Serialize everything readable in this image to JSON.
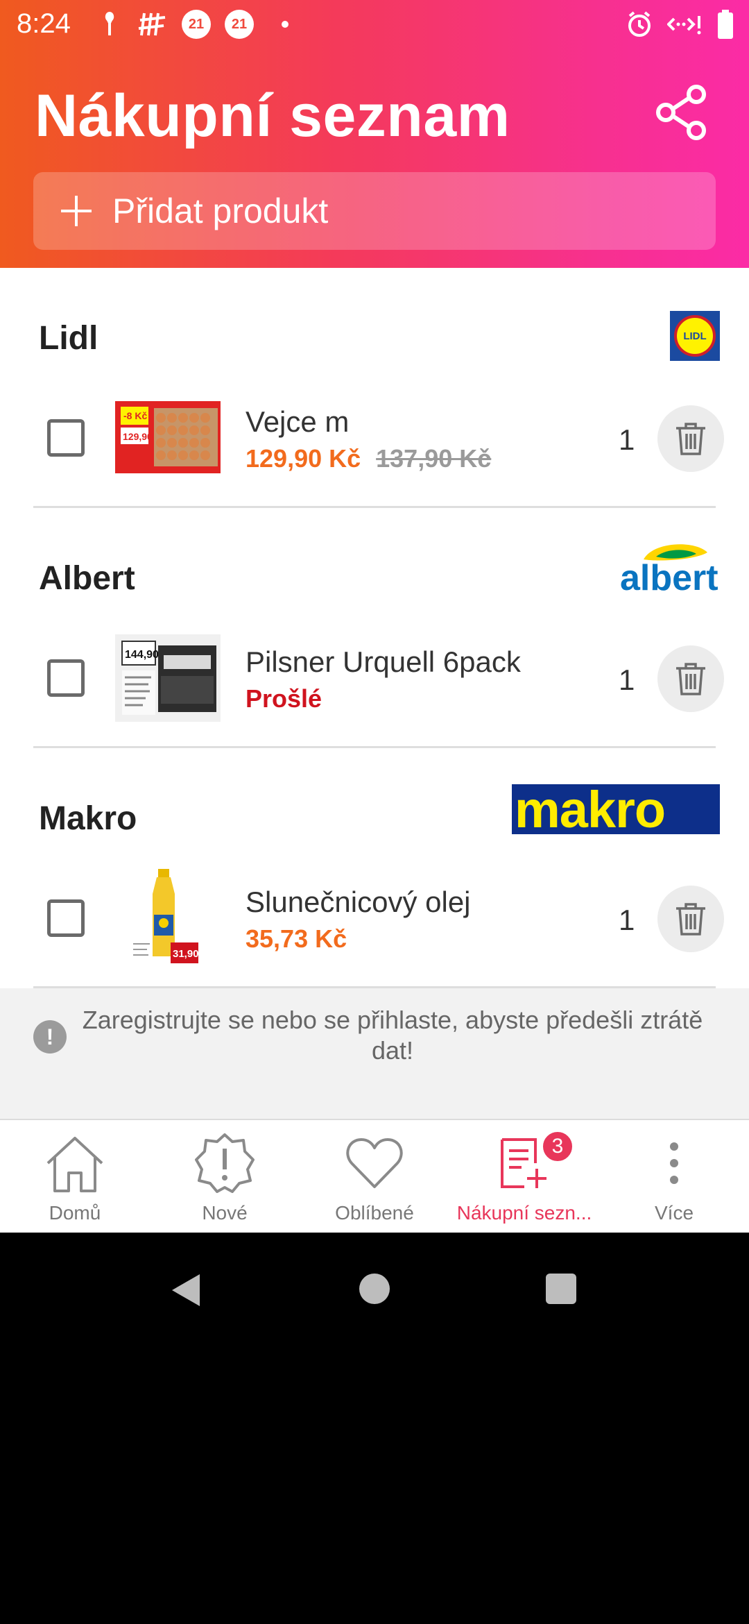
{
  "status_bar": {
    "time": "8:24",
    "badge_1": "21",
    "badge_2": "21"
  },
  "header": {
    "title": "Nákupní seznam",
    "add_product_label": "Přidat produkt"
  },
  "sections": [
    {
      "store": "Lidl",
      "logo": "lidl-logo",
      "item": {
        "name": "Vejce m",
        "price": "129,90 Kč",
        "old_price": "137,90 Kč",
        "qty": "1",
        "thumb": "eggs-image"
      }
    },
    {
      "store": "Albert",
      "logo": "albert-logo",
      "item": {
        "name": "Pilsner Urquell 6pack",
        "status": "Prošlé",
        "qty": "1",
        "thumb": "beer-image"
      }
    },
    {
      "store": "Makro",
      "logo": "makro-logo",
      "item": {
        "name": "Slunečnicový olej",
        "price": "35,73 Kč",
        "qty": "1",
        "thumb": "oil-image"
      }
    }
  ],
  "logos": {
    "lidl": "LIDL",
    "albert": "albert",
    "makro": "makro"
  },
  "thumbs": {
    "eggs_sticker": "-8 Kč",
    "eggs_price": "129,90",
    "beer_price": "144,90",
    "oil_price": "31,90"
  },
  "notice": {
    "text": "Zaregistrujte se nebo se přihlaste, abyste předešli ztrátě dat!"
  },
  "bottom_nav": {
    "items": [
      {
        "label": "Domů",
        "icon": "home-icon"
      },
      {
        "label": "Nové",
        "icon": "alert-badge-icon"
      },
      {
        "label": "Oblíbené",
        "icon": "heart-icon"
      },
      {
        "label": "Nákupní sezn...",
        "icon": "shopping-list-icon",
        "badge": "3",
        "active": true
      },
      {
        "label": "Více",
        "icon": "more-vertical-icon"
      }
    ]
  },
  "colors": {
    "header_start": "#f05a1f",
    "header_end": "#fb2ba6",
    "accent": "#f66a20",
    "price": "#f26b1d",
    "expired": "#d0131e",
    "nav_active": "#e8365a"
  }
}
